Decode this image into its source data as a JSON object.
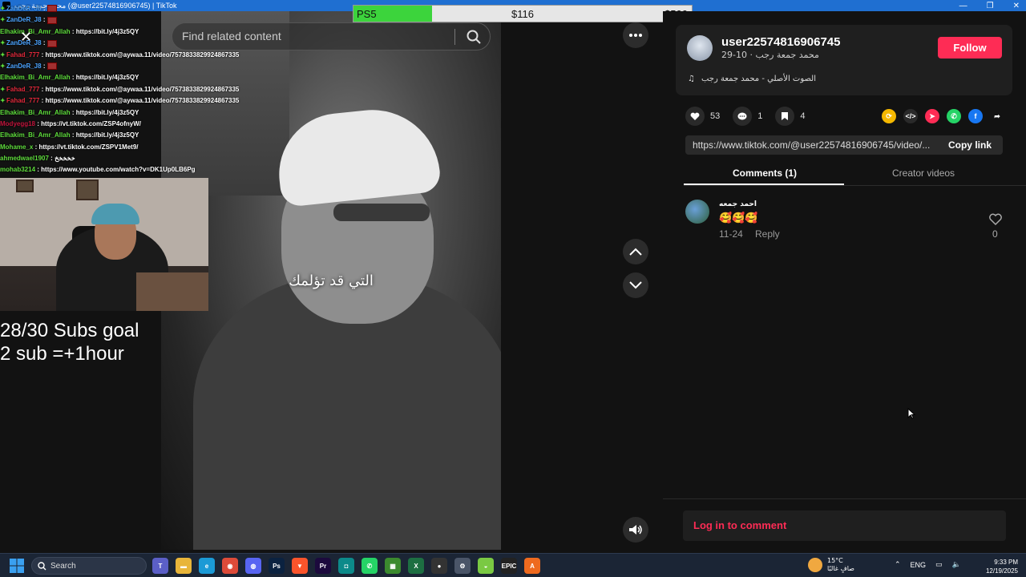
{
  "window": {
    "title": "محمد جمعة رجب (@user22574816906745) | TikTok",
    "controls": [
      "—",
      "❐",
      "✕"
    ]
  },
  "goal_bar": {
    "label": "PS5",
    "current": "$116",
    "target": "$500",
    "progress": 0.232,
    "fill_color": "#3cd43c"
  },
  "video": {
    "search_placeholder": "Find related content",
    "subtitle": "التي قد تؤلمك"
  },
  "chat": [
    {
      "user": "ZanDeR_J8",
      "color": "#4aa3ff",
      "text": ":",
      "emote": true,
      "mark": true
    },
    {
      "user": "ZanDeR_J8",
      "color": "#4aa3ff",
      "text": ":",
      "emote": true,
      "mark": true
    },
    {
      "user": "Elhakim_Bi_Amr_Allah",
      "color": "#5ddb3b",
      "text": ": https://bit.ly/4j3z5QY",
      "emote": false,
      "mark": false
    },
    {
      "user": "ZanDeR_J8",
      "color": "#4aa3ff",
      "text": ":",
      "emote": true,
      "mark": true
    },
    {
      "user": "Fahad_777",
      "color": "#e0283a",
      "text": ": https://www.tiktok.com/@aywaa.11/video/7573833829924867335",
      "emote": false,
      "mark": true
    },
    {
      "user": "ZanDeR_J8",
      "color": "#4aa3ff",
      "text": ":",
      "emote": true,
      "mark": true
    },
    {
      "user": "Elhakim_Bi_Amr_Allah",
      "color": "#5ddb3b",
      "text": ": https://bit.ly/4j3z5QY",
      "emote": false,
      "mark": false
    },
    {
      "user": "Fahad_777",
      "color": "#e0283a",
      "text": ": https://www.tiktok.com/@aywaa.11/video/7573833829924867335",
      "emote": false,
      "mark": true
    },
    {
      "user": "Fahad_777",
      "color": "#e0283a",
      "text": ": https://www.tiktok.com/@aywaa.11/video/7573833829924867335",
      "emote": false,
      "mark": true
    },
    {
      "user": "Elhakim_Bi_Amr_Allah",
      "color": "#5ddb3b",
      "text": ": https://bit.ly/4j3z5QY",
      "emote": false,
      "mark": false
    },
    {
      "user": "Modyegg18",
      "color": "#c0143c",
      "text": ": https://vt.tiktok.com/ZSP4ofnyW/",
      "emote": false,
      "mark": false
    },
    {
      "user": "Elhakim_Bi_Amr_Allah",
      "color": "#5ddb3b",
      "text": ": https://bit.ly/4j3z5QY",
      "emote": false,
      "mark": false
    },
    {
      "user": "Mohame_x",
      "color": "#5ddb3b",
      "text": ": https://vt.tiktok.com/ZSPV1Met9/",
      "emote": false,
      "mark": false
    },
    {
      "user": "ahmedwael1907",
      "color": "#5ddb3b",
      "text": ": خخخخخ",
      "emote": false,
      "mark": false
    },
    {
      "user": "mohab3214",
      "color": "#5ddb3b",
      "text": ": https://www.youtube.com/watch?v=DK1Up0LB6Pg",
      "emote": false,
      "mark": false
    }
  ],
  "subs_goal": {
    "line1": "28/30 Subs goal",
    "line2": "2 sub =+1hour"
  },
  "author": {
    "username": "user22574816906745",
    "meta": "محمد جمعة رجب · 10-29",
    "follow_label": "Follow",
    "music": "الصوت الأصلي - محمد جمعة رجب"
  },
  "stats": {
    "likes": "53",
    "comments": "1",
    "saves": "4"
  },
  "share": {
    "url": "https://www.tiktok.com/@user22574816906745/video/...",
    "copy_label": "Copy link",
    "icons": [
      {
        "name": "repost-icon",
        "color": "#f5b800",
        "glyph": "⟳"
      },
      {
        "name": "embed-icon",
        "color": "#2a2a2a",
        "glyph": "</>"
      },
      {
        "name": "send-icon",
        "color": "#fe2c55",
        "glyph": "➤"
      },
      {
        "name": "whatsapp-icon",
        "color": "#25d366",
        "glyph": "✆"
      },
      {
        "name": "facebook-icon",
        "color": "#1877f2",
        "glyph": "f"
      },
      {
        "name": "forward-icon",
        "color": "transparent",
        "glyph": "➦"
      }
    ]
  },
  "tabs": {
    "comments": "Comments (1)",
    "creator_videos": "Creator videos"
  },
  "comment": {
    "author": "احمد جمعه",
    "text": "🥰🥰🥰",
    "date": "11-24",
    "reply": "Reply",
    "likes": "0"
  },
  "login_prompt": "Log in to comment",
  "taskbar": {
    "search_label": "Search",
    "weather_temp": "15°C",
    "weather_desc": "صافٍ غالبًا",
    "lang": "ENG",
    "time": "9:33 PM",
    "date": "12/19/2025",
    "apps": [
      {
        "name": "teams-icon",
        "color": "#5b5fc7",
        "glyph": "T"
      },
      {
        "name": "file-explorer-icon",
        "color": "#e8b53a",
        "glyph": "▬"
      },
      {
        "name": "edge-icon",
        "color": "#1b9ad6",
        "glyph": "e"
      },
      {
        "name": "chrome-icon",
        "color": "#dd4b39",
        "glyph": "◉"
      },
      {
        "name": "discord-icon",
        "color": "#5865f2",
        "glyph": "◍"
      },
      {
        "name": "photoshop-icon",
        "color": "#0b2240",
        "glyph": "Ps"
      },
      {
        "name": "brave-icon",
        "color": "#fb542b",
        "glyph": "▼"
      },
      {
        "name": "premiere-icon",
        "color": "#1c0a3d",
        "glyph": "Pr"
      },
      {
        "name": "gamepad-icon",
        "color": "#0c8a8a",
        "glyph": "◘"
      },
      {
        "name": "whatsapp-icon",
        "color": "#25d366",
        "glyph": "✆"
      },
      {
        "name": "minecraft-icon",
        "color": "#3b8a2e",
        "glyph": "▦"
      },
      {
        "name": "excel-icon",
        "color": "#1d6f42",
        "glyph": "X"
      },
      {
        "name": "obs-icon",
        "color": "#333333",
        "glyph": "●"
      },
      {
        "name": "settings-icon",
        "color": "#4a5568",
        "glyph": "⚙"
      },
      {
        "name": "chat-app-icon",
        "color": "#7ac943",
        "glyph": "◒"
      },
      {
        "name": "epic-games-icon",
        "color": "#222222",
        "glyph": "EPIC"
      },
      {
        "name": "app-icon",
        "color": "#ee6a1f",
        "glyph": "A"
      }
    ]
  }
}
